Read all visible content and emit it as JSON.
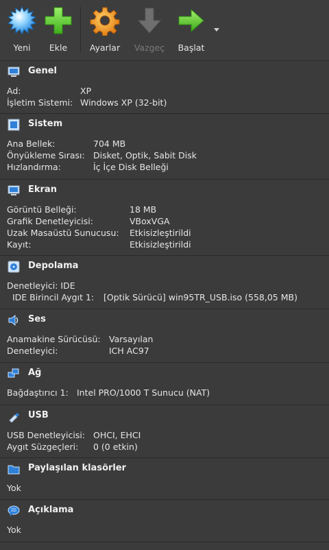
{
  "toolbar": {
    "new_label": "Yeni",
    "add_label": "Ekle",
    "settings_label": "Ayarlar",
    "discard_label": "Vazgeç",
    "start_label": "Başlat"
  },
  "general": {
    "title": "Genel",
    "name_key": "Ad:",
    "name_val": "XP",
    "os_key": "İşletim Sistemi:",
    "os_val": "Windows XP (32-bit)"
  },
  "system": {
    "title": "Sistem",
    "mem_key": "Ana Bellek:",
    "mem_val": "704 MB",
    "boot_key": "Önyükleme Sırası:",
    "boot_val": "Disket, Optik, Sabit Disk",
    "accel_key": "Hızlandırma:",
    "accel_val": "İç İçe Disk Belleği"
  },
  "display": {
    "title": "Ekran",
    "vram_key": "Görüntü Belleği:",
    "vram_val": "18 MB",
    "gc_key": "Grafik Denetleyicisi:",
    "gc_val": "VBoxVGA",
    "rdp_key": "Uzak Masaüstü Sunucusu:",
    "rdp_val": "Etkisizleştirildi",
    "rec_key": "Kayıt:",
    "rec_val": "Etkisizleştirildi"
  },
  "storage": {
    "title": "Depolama",
    "ctrl_line": "Denetleyici: IDE",
    "dev_key": "IDE Birincil Aygıt 1:",
    "dev_val": "[Optik Sürücü] win95TR_USB.iso (558,05 MB)"
  },
  "audio": {
    "title": "Ses",
    "host_key": "Anamakine Sürücüsü:",
    "host_val": "Varsayılan",
    "ctrl_key": "Denetleyici:",
    "ctrl_val": "ICH AC97"
  },
  "network": {
    "title": "Ağ",
    "adapter_key": "Bağdaştırıcı 1:",
    "adapter_val": "Intel PRO/1000 T Sunucu (NAT)"
  },
  "usb": {
    "title": "USB",
    "ctrl_key": "USB Denetleyicisi:",
    "ctrl_val": "OHCI, EHCI",
    "filter_key": "Aygıt Süzgeçleri:",
    "filter_val": "0 (0 etkin)"
  },
  "shared": {
    "title": "Paylaşılan klasörler",
    "value": "Yok"
  },
  "description": {
    "title": "Açıklama",
    "value": "Yok"
  }
}
